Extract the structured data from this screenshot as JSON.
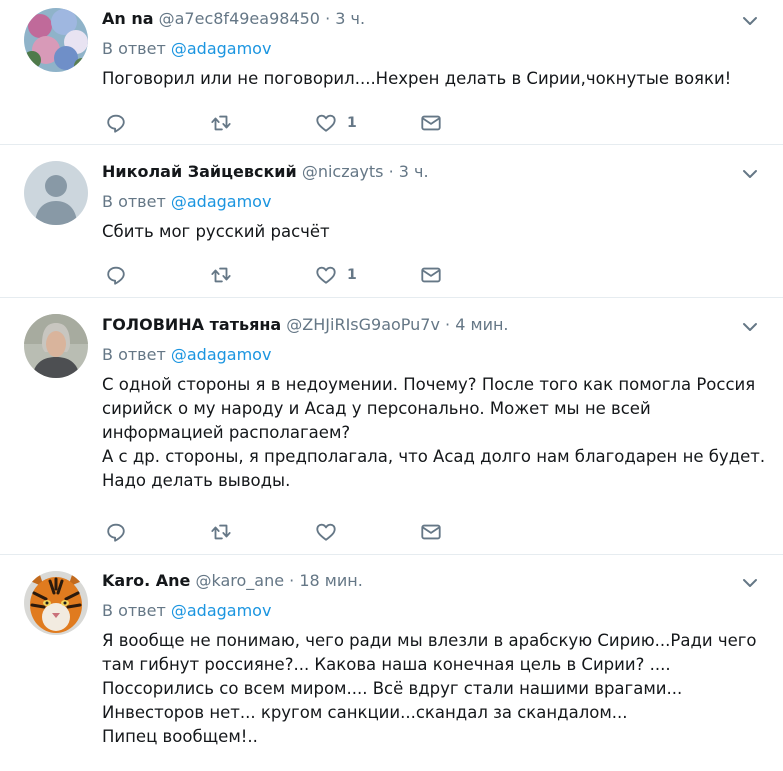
{
  "reply_label": "В ответ",
  "reply_target": "@adagamov",
  "tweets": [
    {
      "name": "An na",
      "handle": "@a7ec8f49ea98450",
      "time": "3 ч.",
      "text": "Поговорил или не поговорил....Нехрен делать в Сирии,чокнутые вояки!",
      "likes": "1"
    },
    {
      "name": "Николай Зайцевский",
      "handle": "@niczayts",
      "time": "3 ч.",
      "text": "Сбить мог русский расчёт",
      "likes": "1"
    },
    {
      "name": "ГОЛОВИНА татьяна",
      "handle": "@ZHJiRIsG9aoPu7v",
      "time": "4 мин.",
      "text": "С одной стороны я в недоумении. Почему? После того как помогла Россия сирийск о му народу и Асад у персонально. Может мы не всей информацией располагаем?\nА с др. стороны, я предполагала, что Асад долго нам благодарен не будет. Надо делать выводы.",
      "likes": ""
    },
    {
      "name": "Karo. Ane",
      "handle": "@karo_ane",
      "time": "18 мин.",
      "text": "Я вообще не понимаю, чего ради мы влезли в арабскую Сирию...Ради чего там гибнут россияне?... Какова наша конечная цель в Сирии? ....\nПоссорились со всем  миром.... Всё вдруг стали нашими врагами...\nИнвесторов нет... кругом санкции...скандал за скандалом...\nПипец вообщем!..",
      "likes": ""
    }
  ],
  "icons": {
    "reply": "reply-icon",
    "retweet": "retweet-icon",
    "like": "heart-icon",
    "dm": "envelope-icon",
    "more": "chevron-down-icon"
  },
  "colors": {
    "link": "#1b95e0",
    "muted": "#657786",
    "icon": "#657786",
    "divider": "#e6ecf0"
  }
}
